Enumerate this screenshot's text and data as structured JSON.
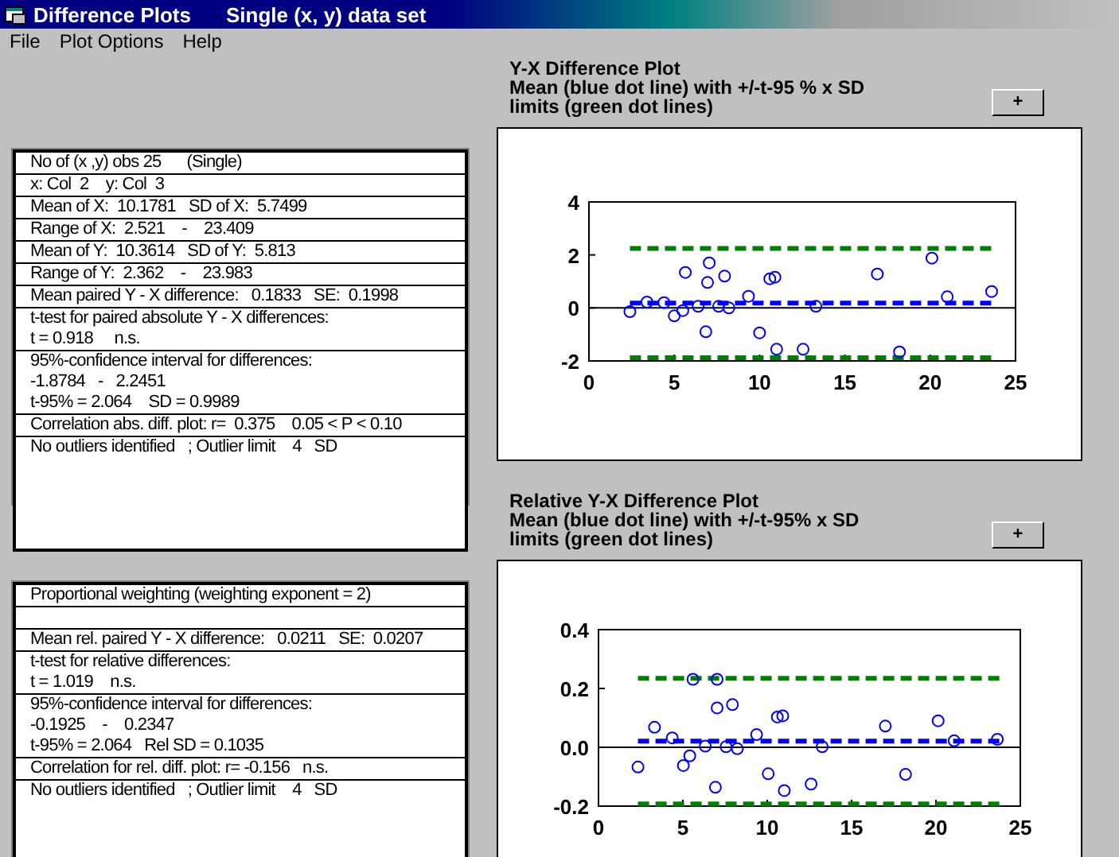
{
  "window": {
    "title": "Difference Plots",
    "subtitle": "Single (x, y) data set"
  },
  "menu": [
    "File",
    "Plot Options",
    "Help"
  ],
  "panels": [
    {
      "groups": [
        {
          "lines": [
            "No of (x ,y) obs 25      (Single)"
          ]
        },
        {
          "lines": [
            "x: Col  2    y: Col  3"
          ]
        },
        {
          "lines": [
            "Mean of X:  10.1781   SD of X:  5.7499"
          ]
        },
        {
          "lines": [
            "Range of X:  2.521    -    23.409"
          ]
        },
        {
          "lines": [
            "Mean of Y:  10.3614   SD of Y:  5.813"
          ]
        },
        {
          "lines": [
            "Range of Y:  2.362    -    23.983"
          ]
        },
        {
          "lines": [
            "Mean paired Y - X difference:   0.1833   SE:  0.1998"
          ]
        },
        {
          "lines": [
            "t-test for paired absolute Y - X differences:",
            "t = 0.918     n.s."
          ]
        },
        {
          "lines": [
            "95%-confidence interval for differences:",
            "-1.8784   -   2.2451",
            "t-95% = 2.064    SD = 0.9989"
          ]
        },
        {
          "lines": [
            "Correlation abs. diff. plot: r=  0.375    0.05 < P < 0.10"
          ]
        },
        {
          "kind": "last",
          "lines": [
            "No outliers identified   ; Outlier limit    4   SD"
          ]
        }
      ]
    },
    {
      "groups": [
        {
          "lines": [
            "Proportional weighting (weighting exponent = 2)"
          ]
        },
        {
          "kind": "blank"
        },
        {
          "lines": [
            "Mean rel. paired Y - X difference:   0.0211   SE:  0.0207"
          ]
        },
        {
          "lines": [
            "t-test for relative differences:",
            "t = 1.019    n.s."
          ]
        },
        {
          "lines": [
            "95%-confidence interval for differences:",
            "-0.1925    -    0.2347",
            "t-95% = 2.064   Rel SD = 0.1035"
          ]
        },
        {
          "lines": [
            "Correlation for rel. diff. plot: r= -0.156   n.s."
          ]
        },
        {
          "kind": "last",
          "lines": [
            "No outliers identified   ; Outlier limit    4   SD"
          ]
        }
      ]
    }
  ],
  "plots": [
    {
      "title_lines": [
        "Y-X Difference Plot",
        "Mean (blue dot line) with +/-t-95 % x SD",
        "limits (green dot lines)"
      ],
      "button": "+",
      "chart_data": {
        "type": "scatter",
        "x": [
          2.4,
          3.4,
          4.4,
          5.0,
          5.5,
          5.65,
          6.4,
          6.85,
          6.95,
          7.05,
          7.6,
          7.95,
          8.2,
          9.35,
          10.0,
          10.6,
          10.9,
          11.0,
          12.55,
          13.3,
          16.9,
          18.2,
          20.1,
          21.0,
          23.6
        ],
        "series": [
          {
            "color": "#0000ff",
            "values": [
              -0.14,
              0.22,
              0.2,
              -0.3,
              -0.1,
              1.34,
              0.06,
              -0.9,
              0.96,
              1.7,
              0.06,
              1.2,
              0,
              0.44,
              -0.94,
              1.1,
              1.16,
              -1.56,
              -1.56,
              0.06,
              1.28,
              -1.66,
              1.88,
              0.42,
              0.62
            ]
          }
        ],
        "xlim": [
          0,
          25
        ],
        "ylim": [
          -2,
          4
        ],
        "xticks": [
          0,
          5,
          10,
          15,
          20,
          25
        ],
        "yticks": [
          -2,
          0,
          2,
          4
        ],
        "ref_lines": [
          {
            "axis": "y",
            "value": 0.1833,
            "color": "#0000ff"
          },
          {
            "axis": "y",
            "value": 2.2451,
            "color": "#008000"
          },
          {
            "axis": "y",
            "value": -1.8784,
            "color": "#008000"
          }
        ]
      }
    },
    {
      "title_lines": [
        "Relative Y-X Difference Plot",
        "Mean (blue dot line) with +/-t-95% x SD",
        "limits (green dot lines)"
      ],
      "button": "+",
      "chart_data": {
        "type": "scatter",
        "x": [
          2.34,
          3.32,
          4.37,
          5.03,
          5.41,
          5.6,
          6.33,
          6.93,
          7.03,
          7.03,
          7.56,
          7.94,
          8.23,
          9.37,
          10.06,
          10.6,
          10.92,
          11.01,
          12.6,
          13.26,
          17.0,
          18.2,
          20.13,
          21.08,
          23.64
        ],
        "series": [
          {
            "color": "#0000ff",
            "values": [
              -0.067,
              0.068,
              0.032,
              -0.062,
              -0.029,
              0.231,
              0.004,
              -0.136,
              0.231,
              0.134,
              0.002,
              0.145,
              -0.005,
              0.043,
              -0.09,
              0.103,
              0.107,
              -0.147,
              -0.125,
              0.002,
              0.072,
              -0.092,
              0.09,
              0.022,
              0.027
            ]
          }
        ],
        "xlim": [
          0,
          25
        ],
        "ylim": [
          -0.2,
          0.4
        ],
        "xticks": [
          0,
          5,
          10,
          15,
          20,
          25
        ],
        "yticks": [
          {
            "value": -0.2,
            "label": "-0.2"
          },
          {
            "value": 0,
            "label": "0.0"
          },
          {
            "value": 0.2,
            "label": "0.2"
          },
          {
            "value": 0.4,
            "label": "0.4"
          }
        ],
        "ref_lines": [
          {
            "axis": "y",
            "value": 0.0211,
            "color": "#0000ff"
          },
          {
            "axis": "y",
            "value": 0.2347,
            "color": "#008000"
          },
          {
            "axis": "y",
            "value": -0.1925,
            "color": "#008000"
          }
        ]
      }
    }
  ]
}
